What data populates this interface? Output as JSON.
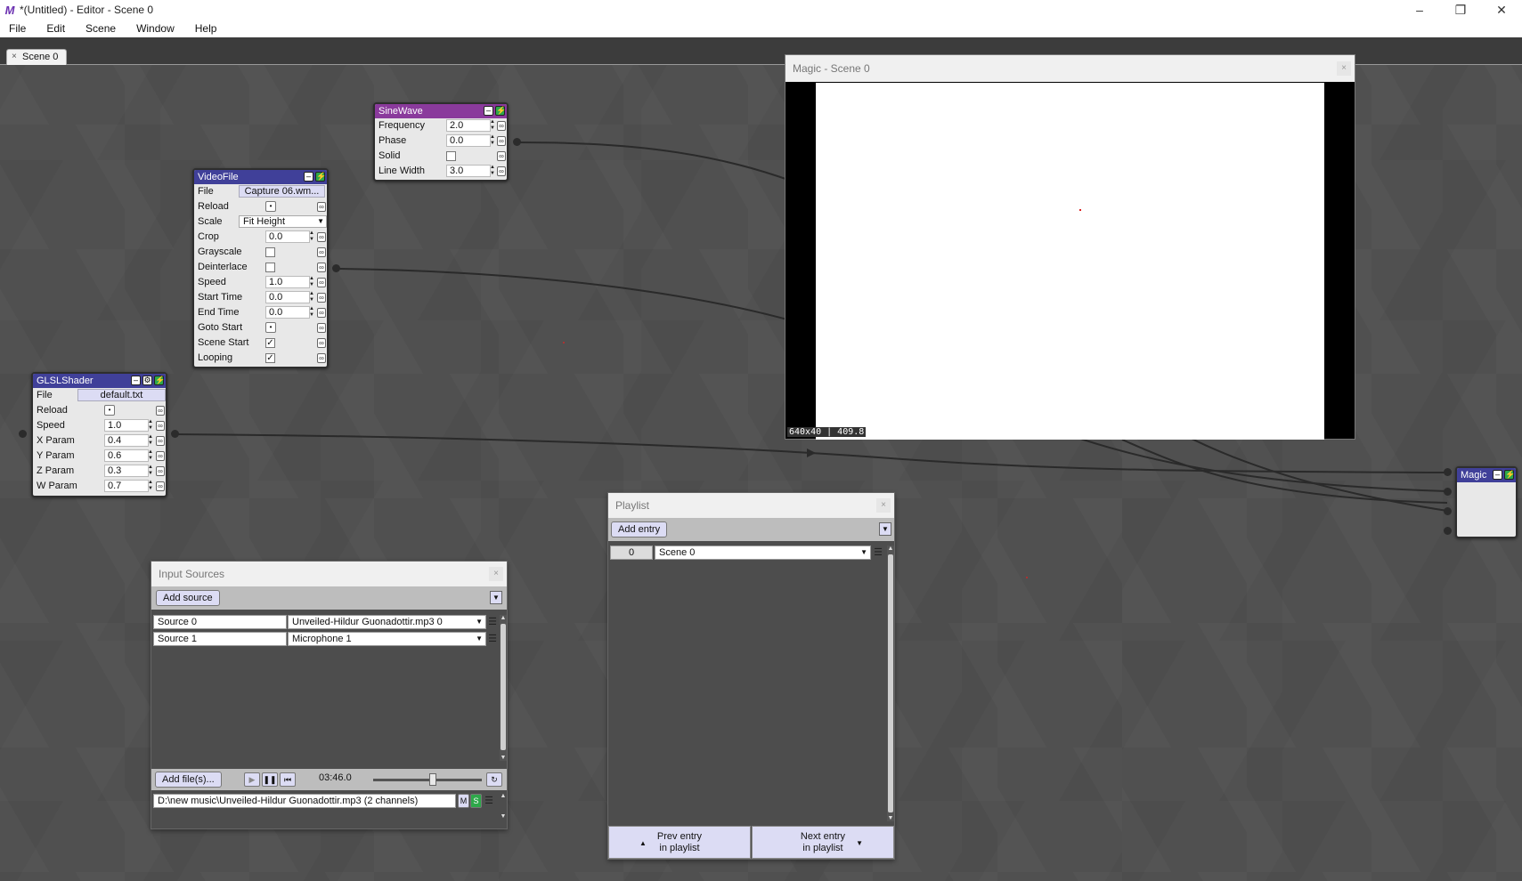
{
  "window": {
    "title": "*(Untitled) - Editor - Scene 0"
  },
  "menu": {
    "items": [
      "File",
      "Edit",
      "Scene",
      "Window",
      "Help"
    ]
  },
  "tabs": [
    {
      "label": "Scene 0"
    }
  ],
  "colors": {
    "header_blue": "#404099",
    "header_purple": "#8a3a9c",
    "link_green": "#2ea84a",
    "button_lavender": "#dcdcf4"
  },
  "nodes": {
    "sinewave": {
      "title": "SineWave",
      "params": [
        {
          "label": "Frequency",
          "value": "2.0"
        },
        {
          "label": "Phase",
          "value": "0.0"
        },
        {
          "label": "Solid",
          "checked": false
        },
        {
          "label": "Line Width",
          "value": "3.0"
        }
      ]
    },
    "videofile": {
      "title": "VideoFile",
      "file": {
        "label": "File",
        "value": "Capture 06.wm..."
      },
      "reload": {
        "label": "Reload"
      },
      "scale": {
        "label": "Scale",
        "value": "Fit Height"
      },
      "crop": {
        "label": "Crop",
        "value": "0.0"
      },
      "grayscale": {
        "label": "Grayscale",
        "checked": false
      },
      "deinterlace": {
        "label": "Deinterlace",
        "checked": false
      },
      "speed": {
        "label": "Speed",
        "value": "1.0"
      },
      "start_time": {
        "label": "Start Time",
        "value": "0.0"
      },
      "end_time": {
        "label": "End Time",
        "value": "0.0"
      },
      "goto_start": {
        "label": "Goto Start"
      },
      "scene_start": {
        "label": "Scene Start",
        "checked": true
      },
      "looping": {
        "label": "Looping",
        "checked": true
      }
    },
    "glslshader": {
      "title": "GLSLShader",
      "file": {
        "label": "File",
        "value": "default.txt"
      },
      "reload": {
        "label": "Reload"
      },
      "speed": {
        "label": "Speed",
        "value": "1.0"
      },
      "x_param": {
        "label": "X Param",
        "value": "0.4"
      },
      "y_param": {
        "label": "Y Param",
        "value": "0.6"
      },
      "z_param": {
        "label": "Z Param",
        "value": "0.3"
      },
      "w_param": {
        "label": "W Param",
        "value": "0.7"
      }
    },
    "magic": {
      "title": "Magic"
    }
  },
  "preview": {
    "title": "Magic - Scene 0",
    "dims": "640x40 | 409.8"
  },
  "input_sources": {
    "title": "Input Sources",
    "add_label": "Add source",
    "rows": [
      {
        "name": "Source 0",
        "device": "Unveiled-Hildur Guonadottir.mp3 0"
      },
      {
        "name": "Source 1",
        "device": "Microphone 1"
      }
    ],
    "add_files_label": "Add file(s)...",
    "time": "03:46.0",
    "volume_level": 0.55,
    "file_path": "D:\\new music\\Unveiled-Hildur Guonadottir.mp3 (2 channels)",
    "mute_label": "M",
    "solo_label": "S"
  },
  "playlist": {
    "title": "Playlist",
    "add_label": "Add entry",
    "entries": [
      {
        "index": "0",
        "scene": "Scene 0"
      }
    ],
    "prev_line1": "Prev entry",
    "prev_line2": "in playlist",
    "next_line1": "Next entry",
    "next_line2": "in playlist"
  }
}
